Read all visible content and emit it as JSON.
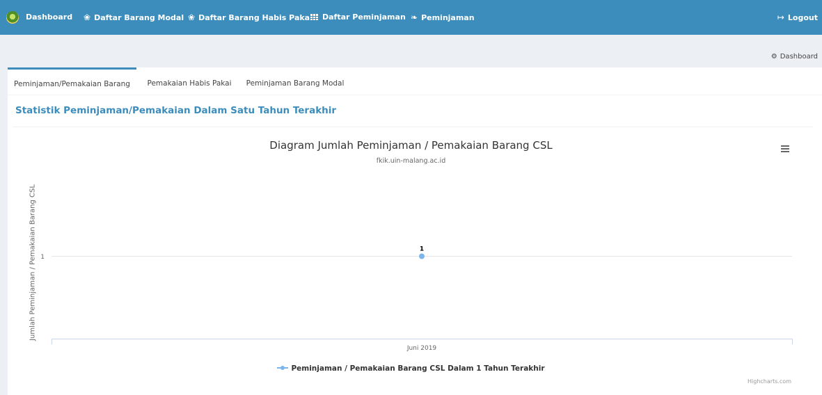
{
  "navbar": {
    "items": [
      {
        "label": "Dashboard",
        "icon": "logo"
      },
      {
        "label": "Daftar Barang Modal",
        "icon": "cubes-icon"
      },
      {
        "label": "Daftar Barang Habis Pakai",
        "icon": "cubes-icon"
      },
      {
        "label": "Daftar Peminjaman",
        "icon": "grid-icon"
      },
      {
        "label": "Peminjaman",
        "icon": "leaf-icon"
      }
    ],
    "logout": {
      "label": "Logout",
      "icon": "sign-out-icon"
    },
    "bg_color": "#3c8dbc"
  },
  "breadcrumb": {
    "label": "Dashboard",
    "icon": "dashboard-icon"
  },
  "tabs": [
    {
      "label": "Peminjaman/Pemakaian Barang",
      "active": true
    },
    {
      "label": "Pemakaian Habis Pakai",
      "active": false
    },
    {
      "label": "Peminjaman Barang Modal",
      "active": false
    }
  ],
  "section": {
    "title": "Statistik Peminjaman/Pemakaian Dalam Satu Tahun Terakhir"
  },
  "chart_data": {
    "type": "line",
    "title": "Diagram Jumlah Peminjaman / Pemakaian Barang CSL",
    "subtitle": "fkik.uin-malang.ac.id",
    "xlabel": "",
    "ylabel": "Jumlah Peminjaman / Pemakaian Barang CSL",
    "categories": [
      "Juni 2019"
    ],
    "yticks": [
      1
    ],
    "series": [
      {
        "name": "Peminjaman / Pemakaian Barang CSL Dalam 1 Tahun Terakhir",
        "values": [
          1
        ],
        "color": "#7cb5ec"
      }
    ],
    "data_labels": true,
    "grid": true,
    "legend": "bottom-center",
    "credits": "Highcharts.com"
  }
}
